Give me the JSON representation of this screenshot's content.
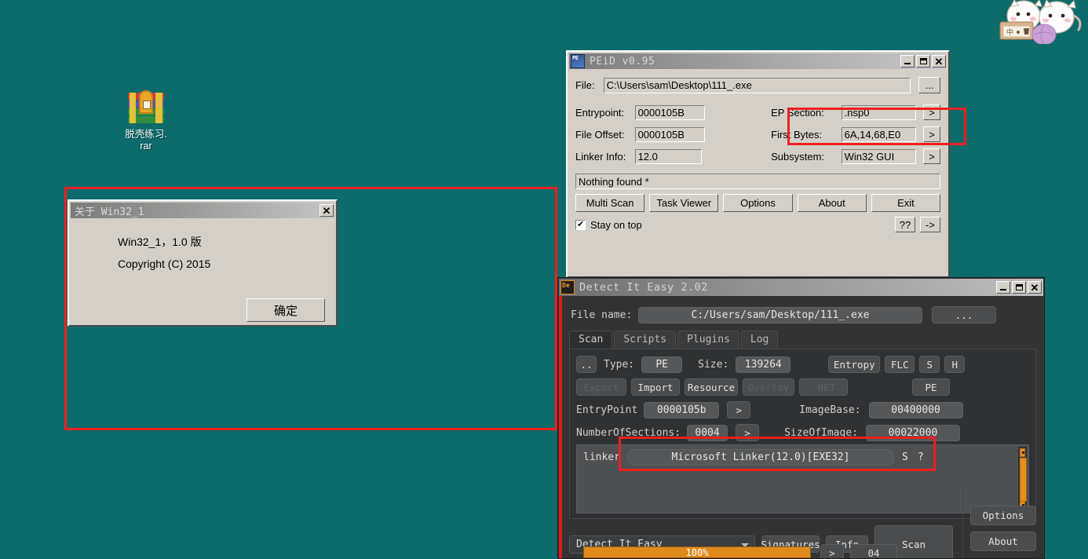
{
  "desktop": {
    "background_color": "#0d6b6b",
    "icon": {
      "name": "rar-archive-icon",
      "label_line1": "脱壳练习.",
      "label_line2": "rar"
    },
    "sticker": {
      "name": "cat-sticker"
    }
  },
  "peid": {
    "title": "PEiD v0.95",
    "icon": "peid-app-icon",
    "window_buttons": {
      "minimize": "minimize",
      "maximize": "maximize",
      "close": "close"
    },
    "file_label": "File:",
    "file_value": "C:\\Users\\sam\\Desktop\\111_.exe",
    "browse_label": "...",
    "fields": [
      {
        "label": "Entrypoint:",
        "value": "0000105B"
      },
      {
        "label": "File Offset:",
        "value": "0000105B"
      },
      {
        "label": "Linker Info:",
        "value": "12.0"
      }
    ],
    "fields_right": [
      {
        "label": "EP Section:",
        "value": ".nsp0",
        "arrow": ">"
      },
      {
        "label": "First Bytes:",
        "value": "6A,14,68,E0",
        "arrow": ">"
      },
      {
        "label": "Subsystem:",
        "value": "Win32 GUI",
        "arrow": ">"
      }
    ],
    "status": "Nothing found *",
    "buttons": [
      "Multi Scan",
      "Task Viewer",
      "Options",
      "About",
      "Exit"
    ],
    "stay_on_top_label": "Stay on top",
    "stay_on_top_checked": true,
    "help_label": "??",
    "next_label": "->"
  },
  "about_dialog": {
    "title": "关于 Win32_1",
    "line1": "Win32_1，1.0 版",
    "line2": "Copyright (C) 2015",
    "ok_label": "确定",
    "close_label": "close"
  },
  "die": {
    "title": "Detect It Easy 2.02",
    "icon": "die-app-icon",
    "file_name_label": "File name:",
    "file_name_value": "C:/Users/sam/Desktop/111_.exe",
    "browse_label": "...",
    "tabs": [
      {
        "label": "Scan",
        "active": true
      },
      {
        "label": "Scripts",
        "active": false
      },
      {
        "label": "Plugins",
        "active": false
      },
      {
        "label": "Log",
        "active": false
      }
    ],
    "row1": {
      "updir_label": "..",
      "type_label": "Type:",
      "type_value": "PE",
      "size_label": "Size:",
      "size_value": "139264",
      "entropy_label": "Entropy",
      "flc_label": "FLC",
      "s_label": "S",
      "h_label": "H"
    },
    "row2": {
      "export_label": "Export",
      "export_enabled": false,
      "import_label": "Import",
      "import_enabled": true,
      "resource_label": "Resource",
      "resource_enabled": true,
      "overlay_label": "Overlay",
      "overlay_enabled": false,
      "net_label": ".NET",
      "net_enabled": false,
      "pe_label": "PE",
      "pe_enabled": true
    },
    "row3": {
      "entrypoint_label": "EntryPoint",
      "entrypoint_value": "0000105b",
      "entrypoint_arrow": ">",
      "imagebase_label": "ImageBase:",
      "imagebase_value": "00400000"
    },
    "row4": {
      "sections_label": "NumberOfSections:",
      "sections_value": "0004",
      "sections_arrow": ">",
      "sizeofimage_label": "SizeOfImage:",
      "sizeofimage_value": "00022000"
    },
    "result": {
      "kind_label": "linker",
      "detection": "Microsoft Linker(12.0)[EXE32]",
      "signature_btn": "S",
      "help_btn": "?"
    },
    "bottom": {
      "engine_select": "Detect It Easy",
      "signatures_label": "Signatures",
      "info_label": "Info",
      "scan_label": "Scan",
      "progress_label": "100%",
      "progress_value": 100,
      "arrow_label": ">",
      "extra_label": "04"
    },
    "side": {
      "options_label": "Options",
      "about_label": "About"
    }
  },
  "annotations": {
    "accent_color": "#ef1f1f",
    "boxes": [
      {
        "name": "annotation-about-dialog-region"
      },
      {
        "name": "annotation-ep-section"
      },
      {
        "name": "annotation-linker-result"
      }
    ]
  }
}
